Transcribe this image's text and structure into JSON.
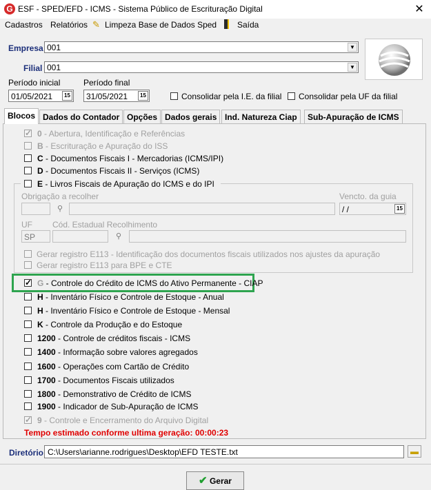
{
  "window": {
    "title": "ESF - SPED/EFD - ICMS - Sistema Público de Escrituração Digital",
    "close": "✕"
  },
  "menu": {
    "cadastros": "Cadastros",
    "relatorios": "Relatórios",
    "limpeza": "Limpeza Base de Dados Sped",
    "saida": "Saída"
  },
  "empresa": {
    "label": "Empresa",
    "value": "001"
  },
  "filial": {
    "label": "Filial",
    "value": "001"
  },
  "periodo": {
    "inicial_label": "Período inicial",
    "inicial_value": "01/05/2021",
    "final_label": "Período final",
    "final_value": "31/05/2021",
    "cal_text": "15"
  },
  "consolidar": {
    "ie": "Consolidar pela I.E. da filial",
    "uf": "Consolidar pela UF da filial"
  },
  "tabs": [
    "Blocos",
    "Dados do Contador",
    "Opções",
    "Dados gerais",
    "Ind. Natureza Ciap",
    "Sub-Apuração de ICMS"
  ],
  "blocos": {
    "b0": {
      "code": "0",
      "text": " - Abertura, Identificação e Referências"
    },
    "bB": {
      "code": "B",
      "text": " - Escrituração e Apuração do ISS"
    },
    "bC": {
      "code": "C",
      "text": " - Documentos Fiscais I - Mercadorias (ICMS/IPI)"
    },
    "bD": {
      "code": "D",
      "text": " - Documentos Fiscais II - Serviços (ICMS)"
    },
    "bE": {
      "code": "E",
      "text": " - Livros Fiscais de Apuração do ICMS e do IPI"
    },
    "obrigacao_label": "Obrigação a recolher",
    "vencto_label": "Vencto. da guia",
    "vencto_value": " / /",
    "uf_label": "UF",
    "uf_value": "SP",
    "cod_label": "Cód. Estadual Recolhimento",
    "e113a": "Gerar registro E113 - Identificação dos documentos fiscais utilizados nos ajustes da apuração",
    "e113b": "Gerar registro E113 para BPE e CTE",
    "bG": {
      "code": "G",
      "text": " - Controle do Crédito de ICMS do Ativo Permanente - CIAP"
    },
    "bH1": {
      "code": "H",
      "text": " - Inventário Físico e Controle de Estoque - Anual"
    },
    "bH2": {
      "code": "H",
      "text": " - Inventário Físico e Controle de Estoque - Mensal"
    },
    "bK": {
      "code": "K",
      "text": " - Controle da Produção e do Estoque"
    },
    "b1200": {
      "code": "1200",
      "text": " - Controle de créditos fiscais - ICMS"
    },
    "b1400": {
      "code": "1400",
      "text": " - Informação sobre valores agregados"
    },
    "b1600": {
      "code": "1600",
      "text": " - Operações com Cartão de Crédito"
    },
    "b1700": {
      "code": "1700",
      "text": " - Documentos Fiscais utilizados"
    },
    "b1800": {
      "code": "1800",
      "text": " - Demonstrativo de Crédito de ICMS"
    },
    "b1900": {
      "code": "1900",
      "text": " - Indicador de Sub-Apuração de ICMS"
    },
    "b9": {
      "code": "9",
      "text": " - Controle e Encerramento do Arquivo Digital"
    }
  },
  "tempo": {
    "label": "Tempo estimado conforme ultima geração:",
    "value": "00:00:23"
  },
  "diretorio": {
    "label": "Diretório",
    "value": "C:\\Users\\arianne.rodrigues\\Desktop\\EFD TESTE.txt"
  },
  "gerar": "Gerar",
  "colors": {
    "accent_green": "#2ea44f",
    "time_red": "#e00000",
    "label_blue": "#1c2f7a"
  }
}
